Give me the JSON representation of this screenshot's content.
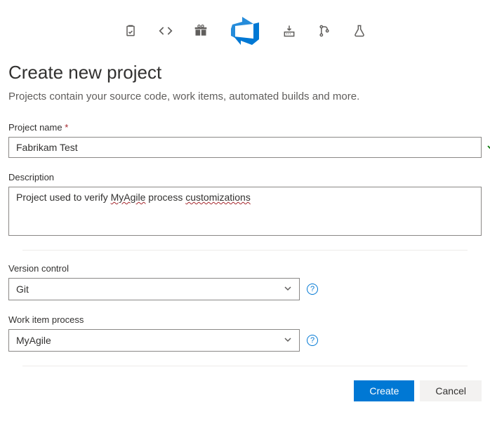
{
  "header": {
    "title": "Create new project",
    "subtitle": "Projects contain your source code, work items, automated builds and more."
  },
  "icons": {
    "clipboard": "clipboard",
    "code": "code",
    "gift": "gift",
    "devops": "azure-devops",
    "download": "download-build",
    "branch": "branch-pull",
    "flask": "flask"
  },
  "fields": {
    "projectName": {
      "label": "Project name",
      "required": "*",
      "value": "Fabrikam Test"
    },
    "description": {
      "label": "Description",
      "value_pre": "Project used to verify ",
      "value_spell1": "MyAgile",
      "value_mid": " process ",
      "value_spell2": "customizations"
    },
    "versionControl": {
      "label": "Version control",
      "value": "Git"
    },
    "workItemProcess": {
      "label": "Work item process",
      "value": "MyAgile"
    }
  },
  "help": "?",
  "buttons": {
    "create": "Create",
    "cancel": "Cancel"
  }
}
